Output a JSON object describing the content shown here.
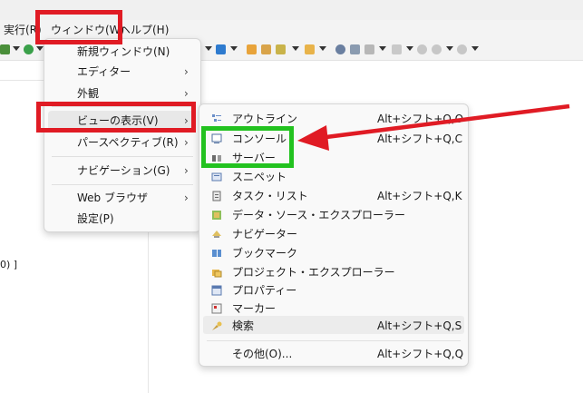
{
  "menubar": {
    "items": [
      {
        "label": "実行(R)"
      },
      {
        "label": "ウィンドウ(W)"
      },
      {
        "label": "ヘルプ(H)"
      }
    ]
  },
  "editor": {
    "fragment": "0) ]"
  },
  "window_menu": {
    "items": [
      {
        "label": "新規ウィンドウ(N)"
      },
      {
        "label": "エディター",
        "submenu": true
      },
      {
        "label": "外観",
        "submenu": true
      },
      {
        "label": "ビューの表示(V)",
        "submenu": true
      },
      {
        "label": "パースペクティブ(R)",
        "submenu": true
      },
      {
        "label": "ナビゲーション(G)",
        "submenu": true
      },
      {
        "label": "Web ブラウザ",
        "submenu": true
      },
      {
        "label": "設定(P)"
      }
    ]
  },
  "show_view_menu": {
    "items": [
      {
        "label": "アウトライン",
        "shortcut": "Alt+シフト+Q,O",
        "icon": "outline-icon"
      },
      {
        "label": "コンソール",
        "shortcut": "Alt+シフト+Q,C",
        "icon": "console-icon"
      },
      {
        "label": "サーバー",
        "shortcut": "",
        "icon": "servers-icon"
      },
      {
        "label": "スニペット",
        "shortcut": "",
        "icon": "snippets-icon"
      },
      {
        "label": "タスク・リスト",
        "shortcut": "Alt+シフト+Q,K",
        "icon": "task-list-icon"
      },
      {
        "label": "データ・ソース・エクスプローラー",
        "shortcut": "",
        "icon": "data-source-icon"
      },
      {
        "label": "ナビゲーター",
        "shortcut": "",
        "icon": "navigator-icon"
      },
      {
        "label": "ブックマーク",
        "shortcut": "",
        "icon": "bookmark-icon"
      },
      {
        "label": "プロジェクト・エクスプローラー",
        "shortcut": "",
        "icon": "project-explorer-icon"
      },
      {
        "label": "プロパティー",
        "shortcut": "",
        "icon": "properties-icon"
      },
      {
        "label": "マーカー",
        "shortcut": "",
        "icon": "markers-icon"
      },
      {
        "label": "検索",
        "shortcut": "Alt+シフト+Q,S",
        "icon": "search-icon"
      },
      {
        "label": "その他(O)...",
        "shortcut": "Alt+シフト+Q,Q",
        "icon": ""
      }
    ]
  },
  "annotations": {
    "red": "#e01b24",
    "green": "#22c21f"
  }
}
